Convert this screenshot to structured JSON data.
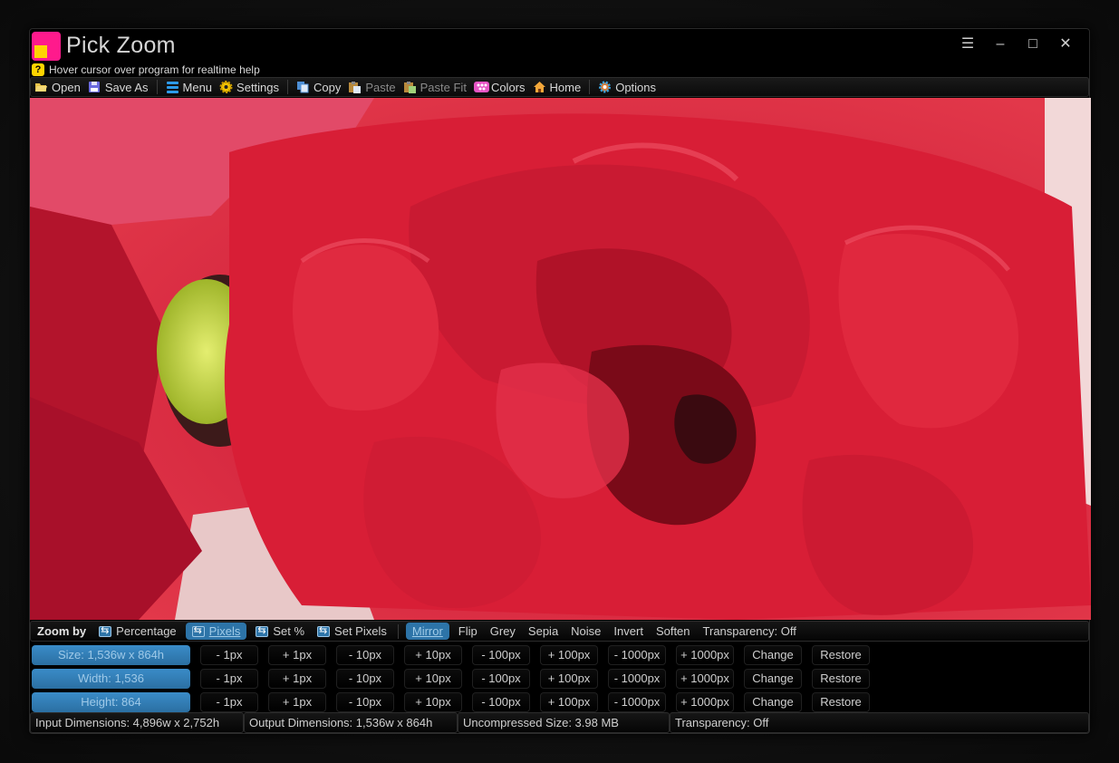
{
  "window": {
    "title": "Pick Zoom",
    "controls": {
      "menu": "☰",
      "minimize": "–",
      "maximize": "□",
      "close": "✕"
    }
  },
  "help": {
    "icon": "?",
    "text": "Hover cursor over program for realtime help"
  },
  "toolbar": {
    "items": [
      {
        "label": "Open",
        "icon": "folder-open-icon"
      },
      {
        "label": "Save As",
        "icon": "floppy-disk-icon"
      },
      {
        "label": "Menu",
        "icon": "menu-lines-icon"
      },
      {
        "label": "Settings",
        "icon": "gear-icon"
      },
      {
        "label": "Copy",
        "icon": "copy-icon"
      },
      {
        "label": "Paste",
        "icon": "clipboard-icon"
      },
      {
        "label": "Paste Fit",
        "icon": "clipboard-fit-icon"
      },
      {
        "label": "Colors",
        "icon": "palette-icon"
      },
      {
        "label": "Home",
        "icon": "home-icon"
      },
      {
        "label": "Options",
        "icon": "options-gear-icon"
      }
    ]
  },
  "zoombar": {
    "label": "Zoom by",
    "items": [
      "Percentage",
      "Pixels",
      "Set %",
      "Set Pixels",
      "Mirror",
      "Flip",
      "Grey",
      "Sepia",
      "Noise",
      "Invert",
      "Soften",
      "Transparency: Off"
    ],
    "active": [
      "Pixels",
      "Mirror"
    ]
  },
  "rows": [
    {
      "label": "Size: 1,536w x 864h"
    },
    {
      "label": "Width: 1,536"
    },
    {
      "label": "Height: 864"
    }
  ],
  "step_buttons": [
    "- 1px",
    "+ 1px",
    "- 10px",
    "+ 10px",
    "- 100px",
    "+ 100px",
    "- 1000px",
    "+ 1000px",
    "Change",
    "Restore"
  ],
  "status": {
    "input": "Input Dimensions: 4,896w x 2,752h",
    "output": "Output Dimensions: 1,536w x 864h",
    "size": "Uncompressed Size: 3.98 MB",
    "transparency": "Transparency: Off"
  },
  "colors": {
    "accent": "#2d74a8",
    "logo_pink": "#ff1a8c",
    "logo_yellow": "#ffd400",
    "rose_red": "#d41c33"
  }
}
